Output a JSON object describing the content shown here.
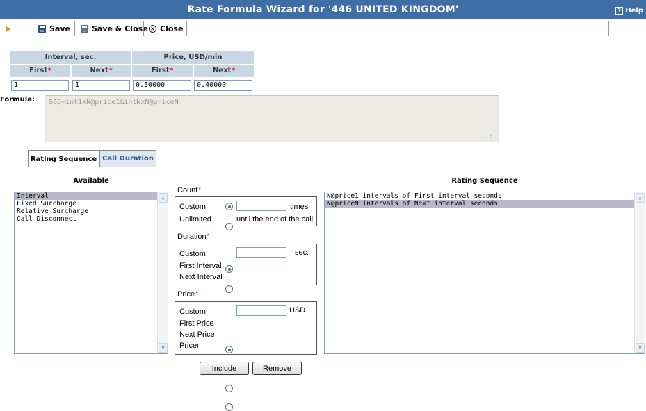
{
  "window": {
    "title": "Rate Formula Wizard for '446 UNITED KINGDOM'",
    "help_label": "Help"
  },
  "toolbar": {
    "save_label": "Save",
    "save_close_label": "Save & Close",
    "close_label": "Close"
  },
  "intervals": {
    "interval_header": "Interval, sec.",
    "price_header": "Price, USD/min",
    "first_label": "First",
    "next_label": "Next",
    "values": {
      "interval_first": "1",
      "interval_next": "1",
      "price_first": "0.30000",
      "price_next": "0.40000"
    },
    "required_mark": "*"
  },
  "formula": {
    "label": "Formula:",
    "value": "SEQ=int1xN@price1&intNxN@priceN"
  },
  "tabs": [
    {
      "label": "Rating Sequence",
      "active": true
    },
    {
      "label": "Call Duration",
      "active": false
    }
  ],
  "available": {
    "title": "Available",
    "items": [
      "Interval",
      "Fixed Surcharge",
      "Relative Surcharge",
      "Call Disconnect"
    ],
    "selected_index": 0
  },
  "count": {
    "label": "Count",
    "options": [
      {
        "label": "Custom",
        "selected": true,
        "suffix": "times"
      },
      {
        "label": "Unlimited",
        "selected": false,
        "suffix": "until the end of the call"
      }
    ]
  },
  "duration": {
    "label": "Duration",
    "options": [
      {
        "label": "Custom",
        "selected": true,
        "suffix": "sec."
      },
      {
        "label": "First Interval",
        "selected": false
      },
      {
        "label": "Next Interval",
        "selected": false
      }
    ]
  },
  "price": {
    "label": "Price",
    "options": [
      {
        "label": "Custom",
        "selected": true,
        "suffix": "USD"
      },
      {
        "label": "First Price",
        "selected": false
      },
      {
        "label": "Next Price",
        "selected": false
      },
      {
        "label": "Pricer",
        "selected": false
      }
    ]
  },
  "rating_sequence": {
    "title": "Rating Sequence",
    "items": [
      "N@price1 intervals of First interval seconds",
      "N@priceN intervals of Next interval seconds"
    ],
    "selected_index": 1
  },
  "buttons": {
    "include_label": "Include",
    "remove_label": "Remove"
  },
  "colors": {
    "titlebar": "#3f6ea6",
    "table_header": "#c9d6e3",
    "required": "#dd0000",
    "accent_tab_text": "#2a5a9a"
  }
}
